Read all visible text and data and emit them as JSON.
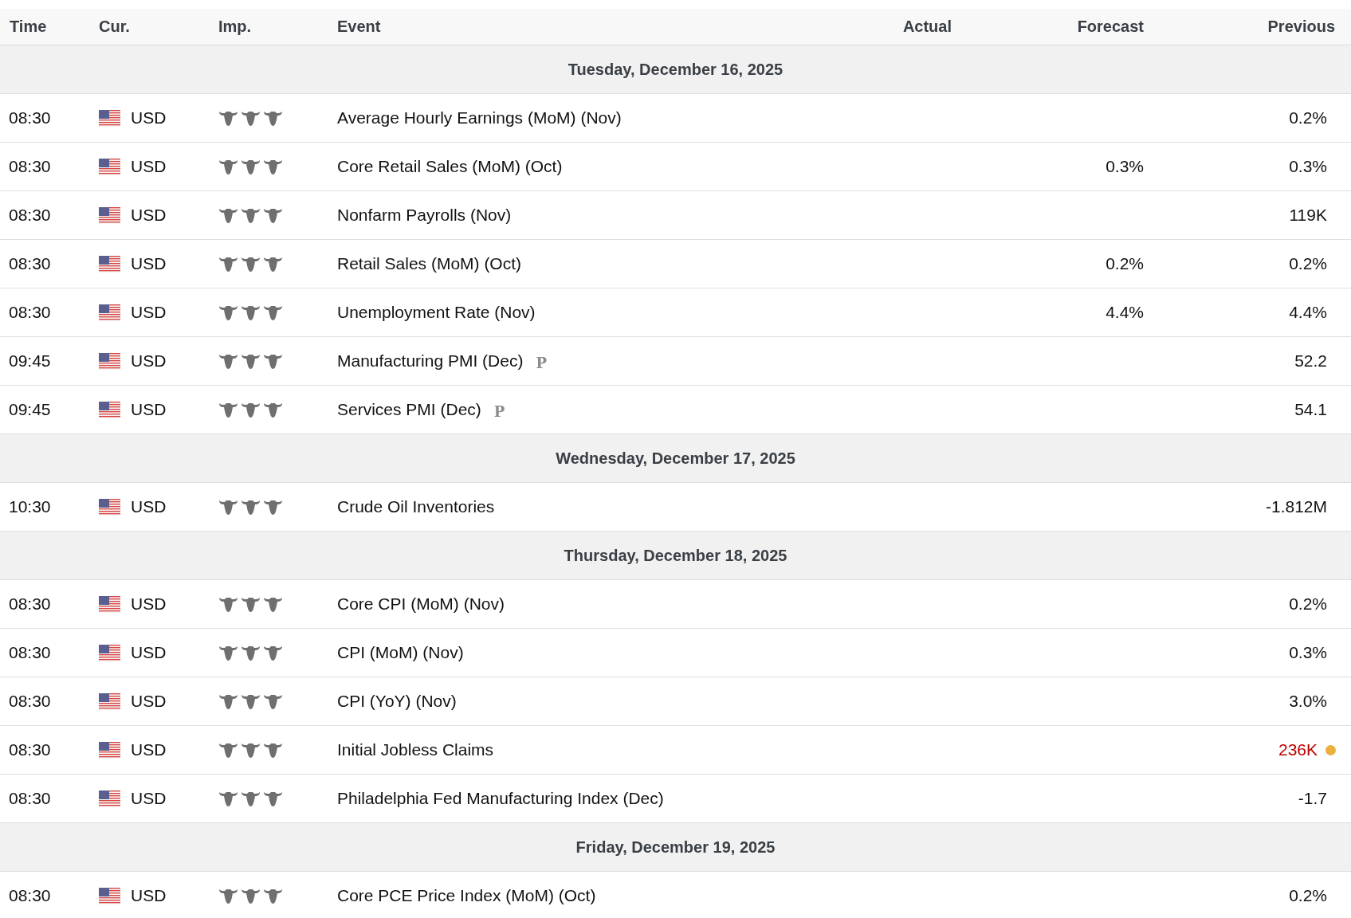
{
  "table": {
    "columns": [
      "Time",
      "Cur.",
      "Imp.",
      "Event",
      "Actual",
      "Forecast",
      "Previous"
    ],
    "groups": [
      {
        "date": "Tuesday, December 16, 2025",
        "events": [
          {
            "time": "08:30",
            "currency": "USD",
            "stars": 3,
            "event": "Average Hourly Earnings (MoM) (Nov)",
            "previous": "0.2%",
            "negative": false
          },
          {
            "time": "08:30",
            "currency": "USD",
            "stars": 3,
            "event": "Core Retail Sales (MoM) (Oct)",
            "forecast": "0.3%",
            "previous": "0.3%",
            "negative": false
          },
          {
            "time": "08:30",
            "currency": "USD",
            "stars": 3,
            "event": "Nonfarm Payrolls (Nov)",
            "previous": "119K",
            "negative": false
          },
          {
            "time": "08:30",
            "currency": "USD",
            "stars": 3,
            "event": "Retail Sales (MoM) (Oct)",
            "forecast": "0.2%",
            "previous": "0.2%",
            "negative": false
          },
          {
            "time": "08:30",
            "currency": "USD",
            "stars": 3,
            "event": "Unemployment Rate (Nov)",
            "forecast": "4.4%",
            "previous": "4.4%",
            "negative": false
          },
          {
            "time": "09:45",
            "currency": "USD",
            "stars": 3,
            "event": "Manufacturing PMI (Dec)",
            "badge": "P",
            "previous": "52.2",
            "negative": false
          },
          {
            "time": "09:45",
            "currency": "USD",
            "stars": 3,
            "event": "Services PMI (Dec)",
            "badge": "P",
            "previous": "54.1",
            "negative": false
          }
        ]
      },
      {
        "date": "Wednesday, December 17, 2025",
        "events": [
          {
            "time": "10:30",
            "currency": "USD",
            "stars": 3,
            "event": "Crude Oil Inventories",
            "previous": "-1.812M",
            "negative": false
          }
        ]
      },
      {
        "date": "Thursday, December 18, 2025",
        "events": [
          {
            "time": "08:30",
            "currency": "USD",
            "stars": 3,
            "event": "Core CPI (MoM) (Nov)",
            "previous": "0.2%",
            "negative": false
          },
          {
            "time": "08:30",
            "currency": "USD",
            "stars": 3,
            "event": "CPI (MoM) (Nov)",
            "previous": "0.3%",
            "negative": false
          },
          {
            "time": "08:30",
            "currency": "USD",
            "stars": 3,
            "event": "CPI (YoY) (Nov)",
            "previous": "3.0%",
            "negative": false
          },
          {
            "time": "08:30",
            "currency": "USD",
            "stars": 3,
            "event": "Initial Jobless Claims",
            "previous": "236K",
            "negative": true,
            "color": "#ecb03f"
          },
          {
            "time": "08:30",
            "currency": "USD",
            "stars": 3,
            "event": "Philadelphia Fed Manufacturing Index (Dec)",
            "previous": "-1.7",
            "negative": false
          }
        ]
      },
      {
        "date": "Friday, December 19, 2025",
        "events": [
          {
            "time": "08:30",
            "currency": "USD",
            "stars": 3,
            "event": "Core PCE Price Index (MoM) (Oct)",
            "previous": "0.2%",
            "negative": false
          }
        ]
      }
    ]
  }
}
